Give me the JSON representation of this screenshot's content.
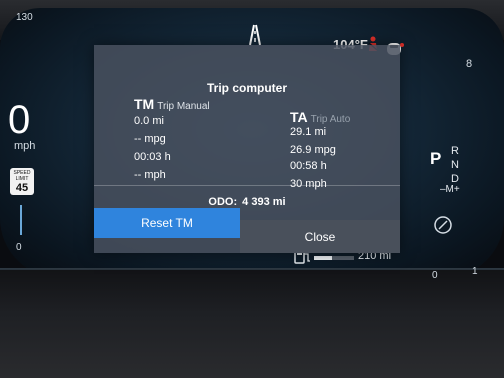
{
  "status": {
    "temperature": "104°F",
    "speed_top": "130",
    "right_top_number": "8"
  },
  "speedometer": {
    "speed": "0",
    "unit": "mph",
    "limit_label": "SPEED LIMIT",
    "limit_value": "45",
    "scale_zero": "0"
  },
  "gear_selector": {
    "p": "P",
    "r": "R",
    "n": "N",
    "d": "D",
    "manual": "–M+"
  },
  "power_gauge": {
    "zero": "0",
    "one": "1"
  },
  "range": {
    "value": "210 mi",
    "fill_fraction": 0.45
  },
  "trip_computer": {
    "title": "Trip computer",
    "manual": {
      "code": "TM",
      "label": "Trip Manual",
      "distance": "0.0 mi",
      "consumption": "-- mpg",
      "time": "00:03 h",
      "avg_speed": "-- mph"
    },
    "auto": {
      "code": "TA",
      "label": "Trip Auto",
      "distance": "29.1 mi",
      "consumption": "26.9 mpg",
      "time": "00:58 h",
      "avg_speed": "30 mph"
    },
    "odo_label": "ODO:",
    "odo_value": "4 393 mi",
    "reset_button": "Reset TM",
    "close_button": "Close"
  },
  "colors": {
    "reset_accent": "#2f84dd",
    "close_bg": "#49505b",
    "alert_red": "#e0302a"
  }
}
